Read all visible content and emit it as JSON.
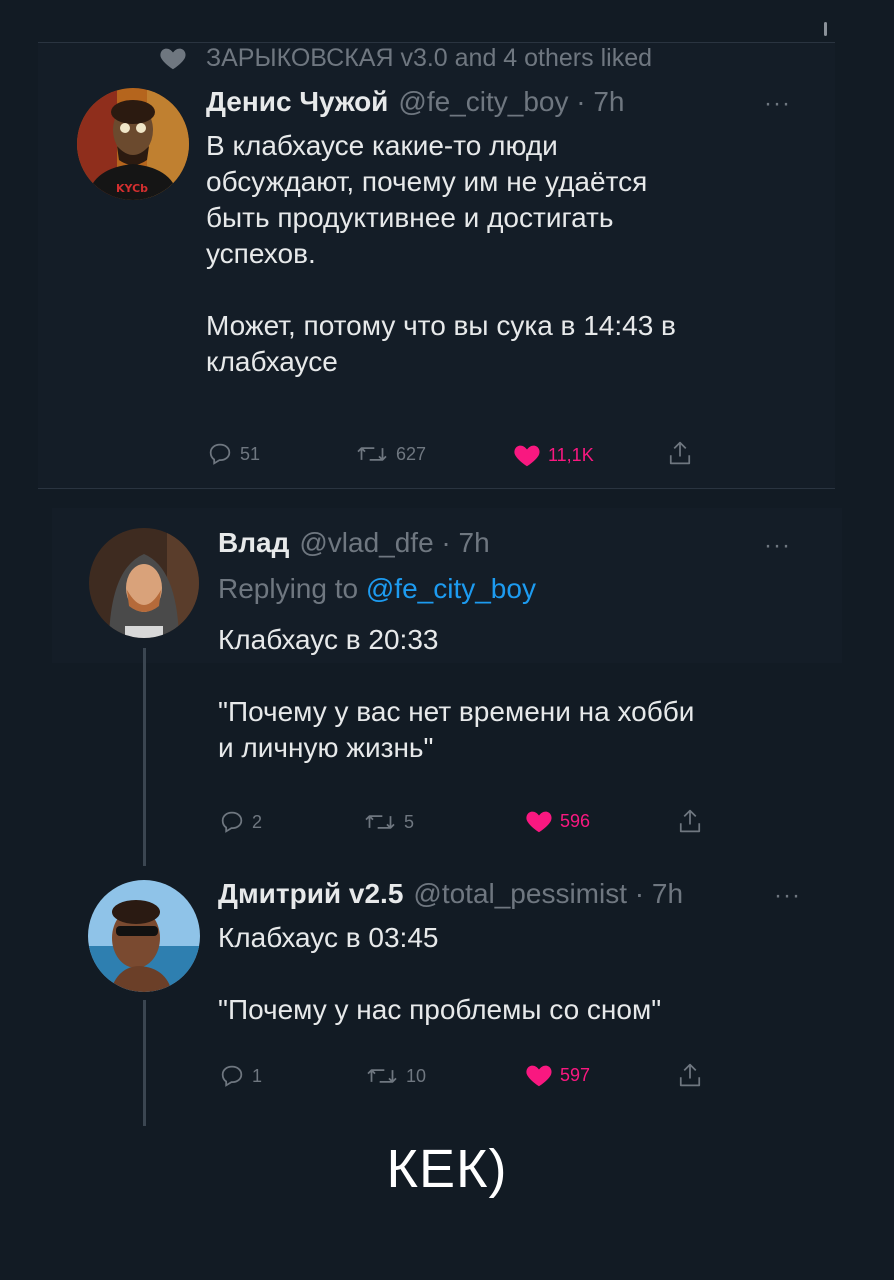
{
  "social_context": {
    "text": "ЗАРЫКОВСКАЯ v3.0 and 4 others liked",
    "icon": "heart-icon"
  },
  "tweets": [
    {
      "name": "Денис Чужой",
      "handle": "@fe_city_boy · 7h",
      "text": "В клабхаусе какие-то люди\nобсуждают, почему им не удаётся\nбыть продуктивнее и достигать\nуспехов.\n\nМожет, потому что вы сука в 14:43 в\nклабхаусе",
      "avatar_shirt_text": "KYCb",
      "replies": "51",
      "retweets": "627",
      "likes": "11,1K"
    },
    {
      "name": "Влад",
      "handle": "@vlad_dfe · 7h",
      "replying_prefix": "Replying to",
      "replying_to": "@fe_city_boy",
      "text": "Клабхаус в 20:33\n\n\"Почему у вас нет времени на хобби\nи личную жизнь\"",
      "replies": "2",
      "retweets": "5",
      "likes": "596"
    },
    {
      "name": "Дмитрий v2.5",
      "handle": "@total_pessimist · 7h",
      "text": "Клабхаус в 03:45\n\n\"Почему у нас проблемы со сном\"",
      "replies": "1",
      "retweets": "10",
      "likes": "597"
    }
  ],
  "more_label": "···",
  "caption": "КЕК)",
  "colors": {
    "background": "#121b24",
    "text": "#e7e9ea",
    "muted": "#6f7780",
    "like": "#f91880",
    "link": "#1d9bf0"
  }
}
